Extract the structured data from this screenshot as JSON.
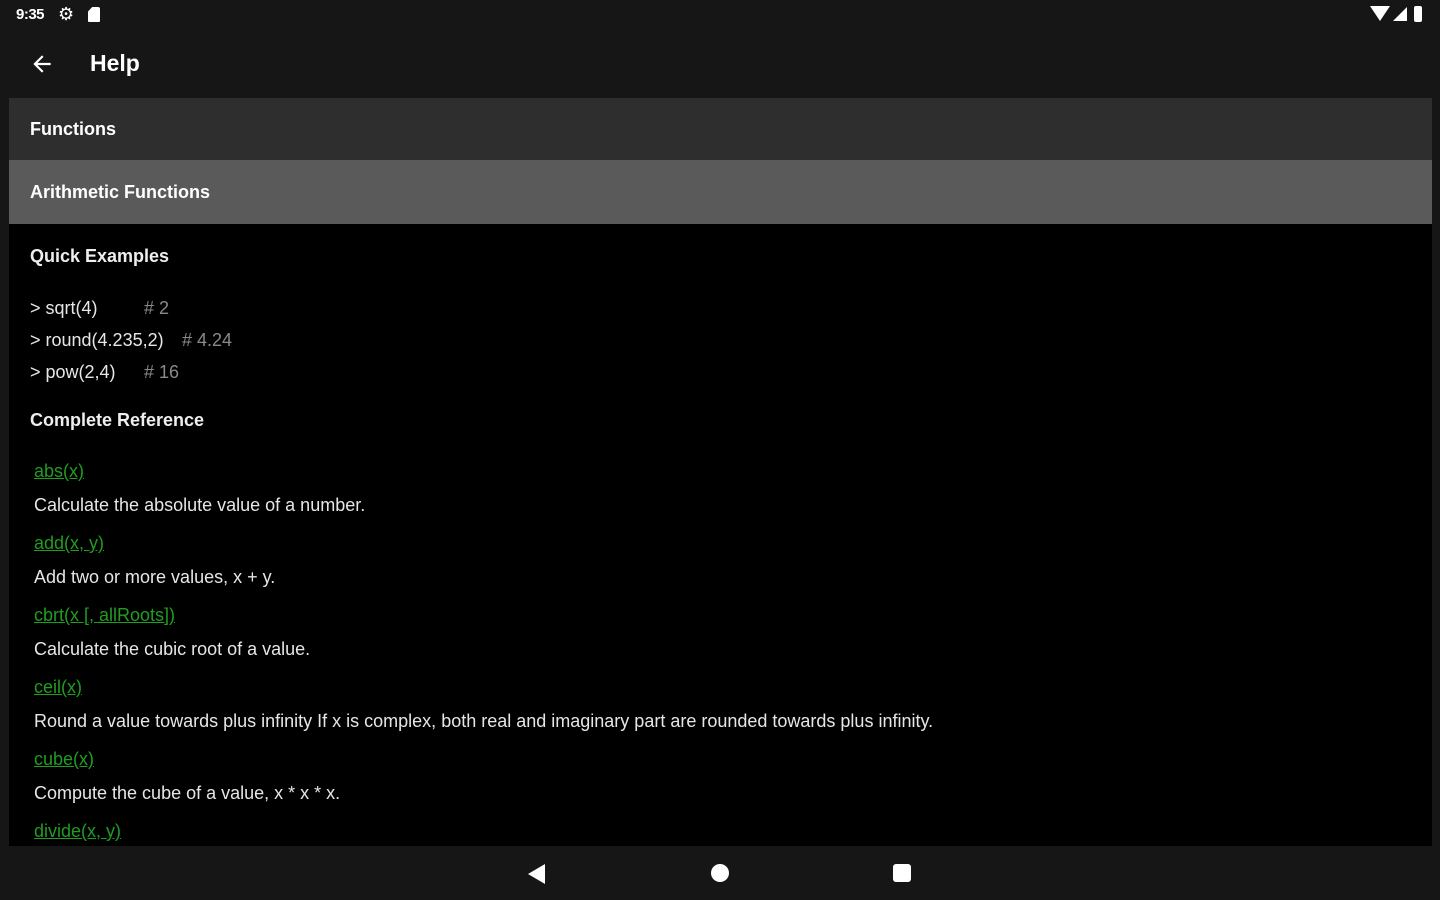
{
  "status_bar": {
    "time": "9:35",
    "icons": [
      "gear-icon",
      "sd-card-icon",
      "wifi-icon",
      "signal-icon",
      "battery-icon"
    ]
  },
  "app_bar": {
    "back_icon": "arrow-left-icon",
    "title": "Help"
  },
  "sections": {
    "functions": "Functions",
    "arithmetic": "Arithmetic Functions"
  },
  "quick_examples": {
    "heading": "Quick Examples",
    "items": [
      {
        "code": "> sqrt(4)",
        "result": "# 2"
      },
      {
        "code": "> round(4.235,2)",
        "result": "# 4.24"
      },
      {
        "code": "> pow(2,4)",
        "result": "# 16"
      }
    ]
  },
  "reference": {
    "heading": "Complete Reference",
    "items": [
      {
        "name": "abs(x)",
        "description": "Calculate the absolute value of a number."
      },
      {
        "name": "add(x, y)",
        "description": "Add two or more values, x + y."
      },
      {
        "name": "cbrt(x [, allRoots])",
        "description": "Calculate the cubic root of a value."
      },
      {
        "name": "ceil(x)",
        "description": "Round a value towards plus infinity If x is complex, both real and imaginary part are rounded towards plus infinity."
      },
      {
        "name": "cube(x)",
        "description": "Compute the cube of a value, x * x * x."
      },
      {
        "name": "divide(x, y)",
        "description": ""
      }
    ]
  },
  "nav_bar": {
    "icons": [
      "back-triangle-icon",
      "home-circle-icon",
      "recents-square-icon"
    ]
  },
  "colors": {
    "link": "#1f9e1f",
    "functions_row": "#2e2e2e",
    "arithmetic_row": "#5a5a5a",
    "background": "#000000"
  }
}
